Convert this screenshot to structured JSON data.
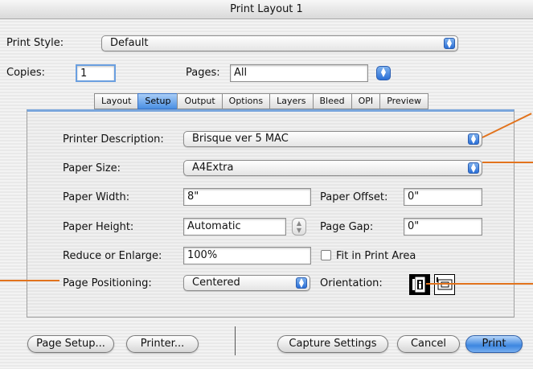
{
  "window": {
    "title": "Print Layout 1"
  },
  "print_style": {
    "label": "Print Style:",
    "value": "Default"
  },
  "copies": {
    "label": "Copies:",
    "value": "1"
  },
  "pages": {
    "label": "Pages:",
    "value": "All"
  },
  "tabs": [
    {
      "label": "Layout",
      "active": false
    },
    {
      "label": "Setup",
      "active": true
    },
    {
      "label": "Output",
      "active": false
    },
    {
      "label": "Options",
      "active": false
    },
    {
      "label": "Layers",
      "active": false
    },
    {
      "label": "Bleed",
      "active": false
    },
    {
      "label": "OPI",
      "active": false
    },
    {
      "label": "Preview",
      "active": false
    }
  ],
  "setup": {
    "printer_description": {
      "label": "Printer Description:",
      "value": "Brisque ver 5 MAC"
    },
    "paper_size": {
      "label": "Paper Size:",
      "value": "A4Extra"
    },
    "paper_width": {
      "label": "Paper Width:",
      "value": "8\""
    },
    "paper_offset": {
      "label": "Paper Offset:",
      "value": "0\""
    },
    "paper_height": {
      "label": "Paper Height:",
      "value": "Automatic"
    },
    "page_gap": {
      "label": "Page Gap:",
      "value": "0\""
    },
    "reduce_enlarge": {
      "label": "Reduce or Enlarge:",
      "value": "100%"
    },
    "fit_in_print_area": {
      "label": "Fit in Print Area",
      "checked": false
    },
    "page_positioning": {
      "label": "Page Positioning:",
      "value": "Centered"
    },
    "orientation": {
      "label": "Orientation:",
      "selected": "portrait"
    }
  },
  "buttons": {
    "page_setup": "Page Setup...",
    "printer": "Printer...",
    "capture_settings": "Capture Settings",
    "cancel": "Cancel",
    "print": "Print"
  },
  "icons": {
    "popup_arrows": "updown-arrows-icon",
    "portrait": "portrait-orientation-icon",
    "landscape": "landscape-orientation-icon"
  },
  "colors": {
    "accent": "#4a8fe3",
    "callout": "#e2731d"
  }
}
